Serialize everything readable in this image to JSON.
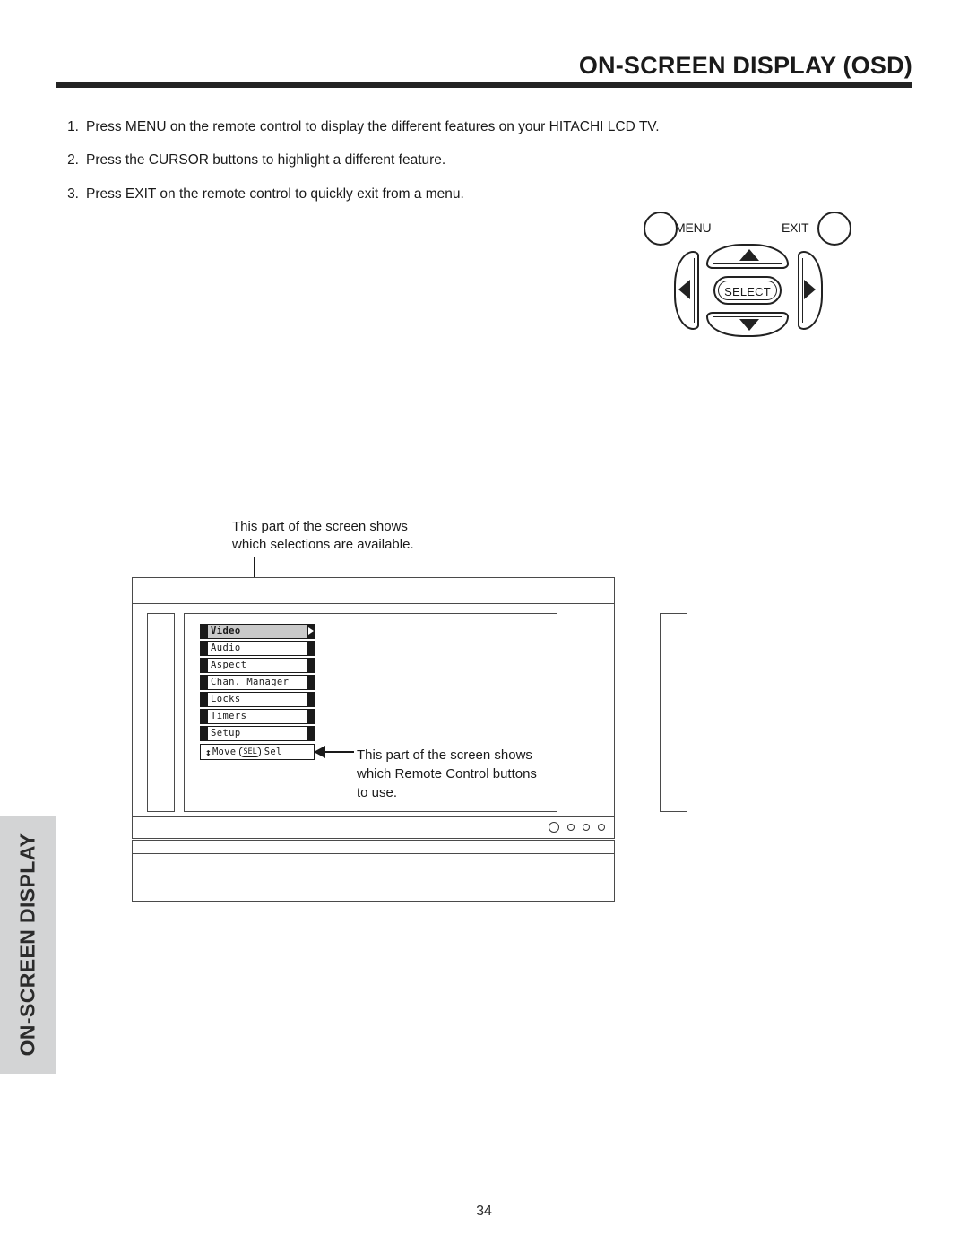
{
  "page": {
    "title": "ON-SCREEN DISPLAY (OSD)",
    "number": "34",
    "side_tab_label": "ON-SCREEN DISPLAY"
  },
  "steps": [
    {
      "num": "1.",
      "text": "Press MENU on the remote control to display the different features on your HITACHI LCD TV."
    },
    {
      "num": "2.",
      "text": "Press the CURSOR buttons to highlight a different feature."
    },
    {
      "num": "3.",
      "text": "Press EXIT on the remote control to quickly exit from a menu."
    }
  ],
  "remote": {
    "menu_label": "MENU",
    "exit_label": "EXIT",
    "select_label": "SELECT",
    "icons": {
      "up": "triangle-up-icon",
      "down": "triangle-down-icon",
      "left": "triangle-left-icon",
      "right": "triangle-right-icon"
    }
  },
  "callouts": {
    "top": {
      "line1": "This part of the screen shows",
      "line2": "which selections are available."
    },
    "bottom": {
      "line1": "This part of the screen shows",
      "line2": "which Remote Control buttons",
      "line3": "to use."
    }
  },
  "osd": {
    "items": [
      {
        "label": "Video",
        "selected": true,
        "submenu_arrow": true
      },
      {
        "label": "Audio",
        "selected": false,
        "submenu_arrow": false
      },
      {
        "label": "Aspect",
        "selected": false,
        "submenu_arrow": false
      },
      {
        "label": "Chan. Manager",
        "selected": false,
        "submenu_arrow": false
      },
      {
        "label": "Locks",
        "selected": false,
        "submenu_arrow": false
      },
      {
        "label": "Timers",
        "selected": false,
        "submenu_arrow": false
      },
      {
        "label": "Setup",
        "selected": false,
        "submenu_arrow": false
      }
    ],
    "footer": {
      "updown_icon": "↕",
      "move_label": "Move",
      "sel_key": "SEL",
      "sel_label": "Sel"
    }
  },
  "tv": {
    "indicator_dots": 4
  },
  "colors": {
    "rule": "#232323",
    "side_tab_bg": "#d3d4d5",
    "osd_highlight": "#c9c9c9",
    "outline": "#4a4a4a"
  }
}
